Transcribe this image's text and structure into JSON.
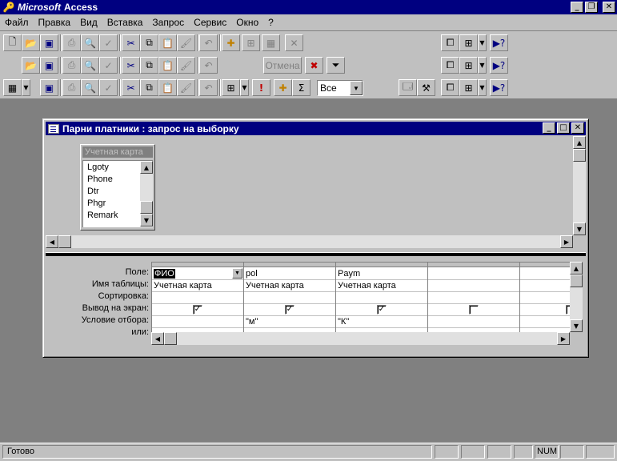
{
  "app": {
    "title_brand": "Microsoft",
    "title_name": "Access"
  },
  "menu": [
    "Файл",
    "Правка",
    "Вид",
    "Вставка",
    "Запрос",
    "Сервис",
    "Окно",
    "?"
  ],
  "toolbar": {
    "cancel_label": "Отмена",
    "values_combo": "Все"
  },
  "query_window": {
    "title": "Парни платники : запрос на выборку",
    "field_list": {
      "title": "Учетная карта",
      "fields": [
        "Lgoty",
        "Phone",
        "Dtr",
        "Phgr",
        "Remark"
      ]
    },
    "row_labels": [
      "Поле:",
      "Имя таблицы:",
      "Сортировка:",
      "Вывод на экран:",
      "Условие отбора:",
      "или:"
    ],
    "columns": [
      {
        "field": "ФИО",
        "table": "Учетная карта",
        "sort": "",
        "show": true,
        "criteria": "",
        "or": ""
      },
      {
        "field": "pol",
        "table": "Учетная карта",
        "sort": "",
        "show": true,
        "criteria": "\"м\"",
        "or": ""
      },
      {
        "field": "Paym",
        "table": "Учетная карта",
        "sort": "",
        "show": true,
        "criteria": "\"К\"",
        "or": ""
      },
      {
        "field": "",
        "table": "",
        "sort": "",
        "show": false,
        "criteria": "",
        "or": ""
      },
      {
        "field": "",
        "table": "",
        "sort": "",
        "show": false,
        "criteria": "",
        "or": ""
      }
    ]
  },
  "status": {
    "text": "Готово",
    "num": "NUM"
  }
}
